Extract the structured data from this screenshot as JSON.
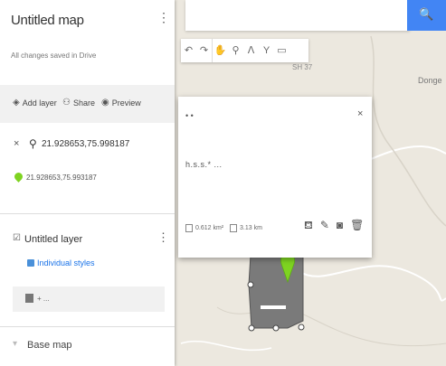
{
  "panel": {
    "title": "Untitled map",
    "menu_glyph": "⋮",
    "saved_status": "All changes saved in Drive",
    "actions": {
      "add_layer": "Add layer",
      "share": "Share",
      "preview": "Preview"
    },
    "search": {
      "close_glyph": "×",
      "query": "21.928653,75.998187"
    },
    "result": {
      "text": "21.928653,75.993187"
    },
    "layer": {
      "check_glyph": "☑",
      "name": "Untitled layer",
      "menu_glyph": "⋮",
      "style_link": "Individual styles",
      "feature_text": "+ ..."
    },
    "basemap": {
      "check_glyph": "▾",
      "label": "Base map"
    }
  },
  "map": {
    "search_icon": "search-icon",
    "search_glyph": "🔍",
    "labels": {
      "place": "Donge",
      "road": "SH 37"
    },
    "toolbar": {
      "undo_glyph": "↶",
      "redo_glyph": "↷",
      "hand_glyph": "✋",
      "marker_glyph": "⚲",
      "line_glyph": "ⴷ",
      "route_glyph": "Y",
      "measure_glyph": "▭"
    },
    "polygon_color": "#7a7a7a",
    "marker_color": "#7ed321",
    "accent": "#4285f4"
  },
  "popup": {
    "header": "• •",
    "close_glyph": "×",
    "description": "h.s.s.* ...",
    "area": "0.612 km²",
    "perimeter": "3.13 km"
  }
}
